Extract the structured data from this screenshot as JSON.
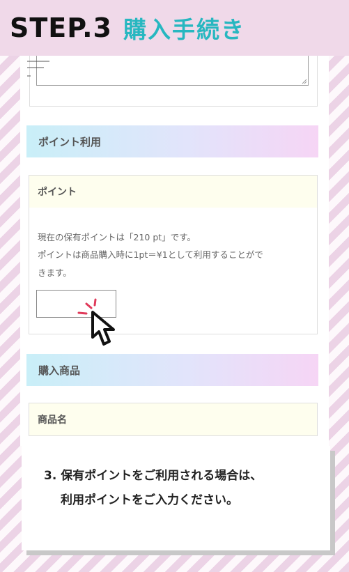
{
  "header": {
    "step": "STEP.3",
    "title": "購入手続き",
    "title_color": "#27b7c0"
  },
  "sections": {
    "point_usage": "ポイント利用",
    "purchase_items": "購入商品"
  },
  "labels": {
    "point": "ポイント",
    "product_name": "商品名"
  },
  "point_info": {
    "line1": "現在の保有ポイントは「210 pt」です。",
    "line2": "ポイントは商品購入時に1pt＝¥1として利用することがで",
    "line3": "きます。"
  },
  "point_input": {
    "value": ""
  },
  "callout": {
    "line1": "3. 保有ポイントをご利用される場合は、",
    "line2": "利用ポイントをご入力ください。"
  },
  "icons": {
    "cursor": "pointer-cursor-icon",
    "click_burst": "click-burst-icon"
  }
}
